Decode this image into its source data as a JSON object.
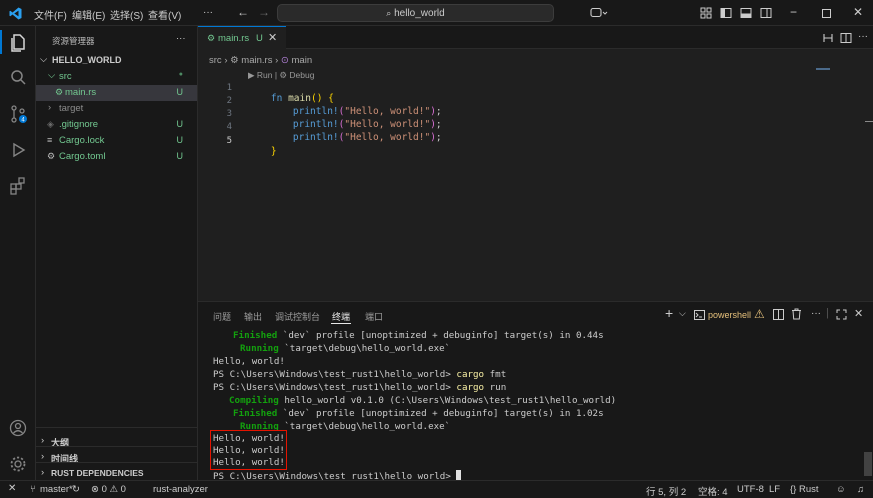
{
  "titlebar": {
    "menu": [
      "文件(F)",
      "编辑(E)",
      "选择(S)",
      "查看(V)",
      "···"
    ],
    "search": "hello_world"
  },
  "sidebar": {
    "title": "资源管理器",
    "more": "···",
    "root": "HELLO_WORLD",
    "items": [
      {
        "label": "src",
        "badge": "●"
      },
      {
        "label": "main.rs",
        "badge": "U"
      },
      {
        "label": "target",
        "badge": ""
      },
      {
        "label": ".gitignore",
        "badge": "U"
      },
      {
        "label": "Cargo.lock",
        "badge": "U"
      },
      {
        "label": "Cargo.toml",
        "badge": "U"
      }
    ],
    "bottom_sections": [
      "大纲",
      "时间线",
      "RUST DEPENDENCIES"
    ]
  },
  "tab": {
    "label": "main.rs",
    "status": "U"
  },
  "breadcrumb": {
    "folder": "src",
    "file": "main.rs",
    "symbol": "main"
  },
  "editor": {
    "codelens": "▶ Run | ⚙ Debug",
    "line_numbers": [
      "1",
      "2",
      "3",
      "4",
      "5"
    ],
    "line1_kw": "fn",
    "line1_fn": "main",
    "line1_rest": "() {",
    "println_macro": "println!",
    "println_arg": "\"Hello, world!\"",
    "close_brace": "}"
  },
  "panel": {
    "tabs": [
      "问题",
      "输出",
      "调试控制台",
      "终端",
      "端口"
    ],
    "active_tab_index": 3,
    "shell_label": "powershell"
  },
  "terminal": {
    "l1_keyword": "Finished",
    "l1_rest": " `dev` profile [unoptimized + debuginfo] target(s) in 0.44s",
    "l2_keyword": "Running",
    "l2_rest": " `target\\debug\\hello_world.exe`",
    "l3": "Hello, world!",
    "prompt": "PS C:\\Users\\Windows\\test_rust1\\hello_world>",
    "cmd1_word": "cargo",
    "cmd1_arg": "fmt",
    "cmd2_word": "cargo",
    "cmd2_arg": "run",
    "l6_keyword": "Compiling",
    "l6_rest": " hello_world v0.1.0 (C:\\Users\\Windows\\test_rust1\\hello_world)",
    "l7_keyword": "Finished",
    "l7_rest": " `dev` profile [unoptimized + debuginfo] target(s) in 1.02s",
    "l8_keyword": "Running",
    "l8_rest": " `target\\debug\\hello_world.exe`",
    "output": [
      "Hello, world!",
      "Hello, world!",
      "Hello, world!"
    ],
    "final_prompt": "PS C:\\Users\\Windows\\test_rust1\\hello_world>"
  },
  "statusbar": {
    "branch": "master*",
    "problems": "⊗ 0 ⚠ 0",
    "rust_analyzer": "rust-analyzer",
    "position": "行 5, 列 2",
    "indent": "空格: 4",
    "encoding": "UTF-8",
    "eol": "LF",
    "language": "{} Rust"
  },
  "colors": {
    "accent": "#0078d4",
    "untracked": "#73c991",
    "keyword": "#569cd6",
    "function": "#dcdcaa",
    "macro": "#569cd6",
    "string": "#ce9178",
    "term_green": "#13a10e",
    "term_yellow": "#f9f1a5",
    "highlight_box": "#e51400"
  }
}
